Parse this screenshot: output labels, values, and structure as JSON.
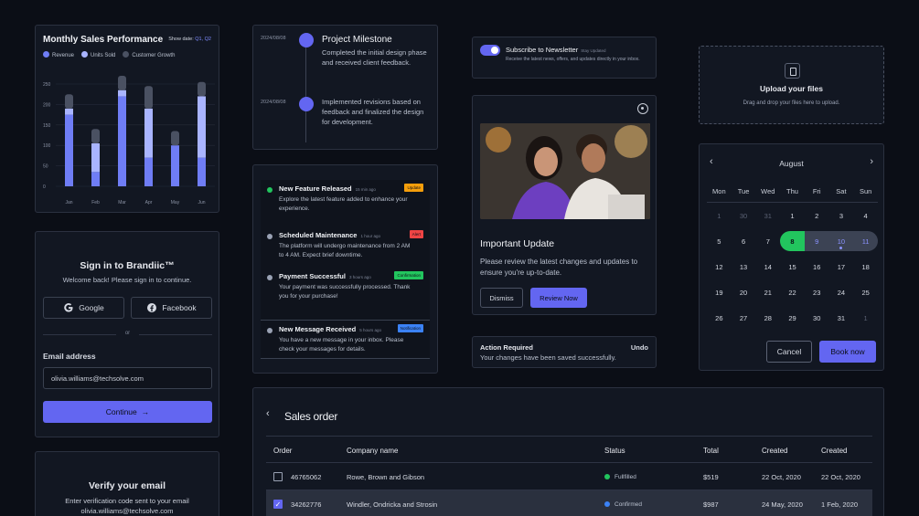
{
  "sales_chart": {
    "title": "Monthly Sales Performance",
    "show_date_label": "Show date:",
    "quarters": "Q1, Q2",
    "legend": [
      {
        "name": "Revenue",
        "color": "#6f7df5"
      },
      {
        "name": "Units Sold",
        "color": "#a9b4ff"
      },
      {
        "name": "Customer Growth",
        "color": "#4a5162"
      }
    ]
  },
  "chart_data": {
    "type": "bar",
    "stacked": true,
    "title": "Monthly Sales Performance",
    "categories": [
      "Jan",
      "Feb",
      "Mar",
      "Apr",
      "May",
      "Jun"
    ],
    "yticks": [
      0,
      50,
      100,
      150,
      200,
      250
    ],
    "ylim": [
      0,
      250
    ],
    "series": [
      {
        "name": "Revenue",
        "color": "#6f7df5",
        "values": [
          175,
          35,
          220,
          70,
          100,
          70
        ]
      },
      {
        "name": "Units Sold",
        "color": "#a9b4ff",
        "values": [
          15,
          70,
          15,
          120,
          0,
          150
        ]
      },
      {
        "name": "Customer Growth",
        "color": "#4a5162",
        "values": [
          35,
          35,
          35,
          55,
          35,
          35
        ]
      }
    ],
    "grid": true
  },
  "milestone": {
    "title": "Project Milestone",
    "items": [
      {
        "date": "2024/08/08",
        "text": "Completed the initial design phase and received client feedback."
      },
      {
        "date": "2024/08/08",
        "text": "Implemented revisions based on feedback and finalized the design for development."
      }
    ]
  },
  "notifications": [
    {
      "title": "New Feature Released",
      "time": "15 min ago",
      "text": "Explore the latest feature added to enhance your experience.",
      "tag": "Update",
      "tag_color": "#f59e0b",
      "dot_color": "#22c55e"
    },
    {
      "title": "Scheduled Maintenance",
      "time": "1 hour ago",
      "text": "The platform will undergo maintenance from 2 AM to 4 AM. Expect brief downtime.",
      "tag": "Alert",
      "tag_color": "#ef4444",
      "dot_color": "#9aa2b4"
    },
    {
      "title": "Payment Successful",
      "time": "3 hours ago",
      "text": "Your payment was successfully processed. Thank you for your purchase!",
      "tag": "Confirmation",
      "tag_color": "#22c55e",
      "dot_color": "#9aa2b4"
    },
    {
      "title": "New Message Received",
      "time": "5 hours ago",
      "text": "You have a new message in your inbox. Please check your messages for details.",
      "tag": "Notification",
      "tag_color": "#3b82f6",
      "dot_color": "#9aa2b4"
    }
  ],
  "signin": {
    "title": "Sign in to Brandiic™",
    "subtitle": "Welcome back! Please sign in to continue.",
    "google": "Google",
    "facebook": "Facebook",
    "or": "or",
    "email_label": "Email address",
    "email_value": "olivia.williams@techsolve.com",
    "continue": "Continue"
  },
  "verify": {
    "title": "Verify your email",
    "line1": "Enter verification code sent to your email",
    "line2": "olivia.williams@techsolve.com"
  },
  "newsletter": {
    "title": "Subscribe to Newsletter",
    "status": "Stay Updated",
    "desc": "Receive the latest news, offers, and updates directly in your inbox."
  },
  "update": {
    "title": "Important Update",
    "desc": "Please review the latest changes and updates to ensure you're up-to-date.",
    "dismiss": "Dismiss",
    "review": "Review Now"
  },
  "action": {
    "title": "Action Required",
    "desc": "Your changes have been saved successfully.",
    "undo": "Undo"
  },
  "upload": {
    "title": "Upload your files",
    "desc": "Drag and drop your files here to upload."
  },
  "calendar": {
    "month": "August",
    "weekdays": [
      "Mon",
      "Tue",
      "Wed",
      "Thu",
      "Fri",
      "Sat",
      "Sun"
    ],
    "days": [
      {
        "d": "1",
        "out": true
      },
      {
        "d": "30",
        "out": true
      },
      {
        "d": "31",
        "out": true
      },
      {
        "d": "1"
      },
      {
        "d": "2"
      },
      {
        "d": "3"
      },
      {
        "d": "4"
      },
      {
        "d": "5"
      },
      {
        "d": "6"
      },
      {
        "d": "7"
      },
      {
        "d": "8",
        "sel": true
      },
      {
        "d": "9",
        "rng": true
      },
      {
        "d": "10",
        "rng": true,
        "today": true
      },
      {
        "d": "11",
        "rng": true,
        "end": true
      },
      {
        "d": "12"
      },
      {
        "d": "13"
      },
      {
        "d": "14"
      },
      {
        "d": "15"
      },
      {
        "d": "16"
      },
      {
        "d": "17"
      },
      {
        "d": "18"
      },
      {
        "d": "19"
      },
      {
        "d": "20"
      },
      {
        "d": "21"
      },
      {
        "d": "22"
      },
      {
        "d": "23"
      },
      {
        "d": "24"
      },
      {
        "d": "25"
      },
      {
        "d": "26"
      },
      {
        "d": "27"
      },
      {
        "d": "28"
      },
      {
        "d": "29"
      },
      {
        "d": "30"
      },
      {
        "d": "31"
      },
      {
        "d": "1",
        "out": true
      }
    ],
    "cancel": "Cancel",
    "book": "Book now"
  },
  "orders": {
    "title": "Sales order",
    "headers": [
      "Order",
      "Company name",
      "Status",
      "Total",
      "Created",
      "Created"
    ],
    "rows": [
      {
        "checked": false,
        "order": "46765062",
        "company": "Rowe, Brown and Gibson",
        "status": "Fullfilled",
        "status_color": "#22c55e",
        "total": "$519",
        "created1": "22 Oct, 2020",
        "created2": "22 Oct, 2020"
      },
      {
        "checked": true,
        "order": "34262776",
        "company": "Windler, Ondricka and Strosin",
        "status": "Confirmed",
        "status_color": "#3b82f6",
        "total": "$987",
        "created1": "24 May, 2020",
        "created2": "1 Feb, 2020"
      }
    ]
  }
}
